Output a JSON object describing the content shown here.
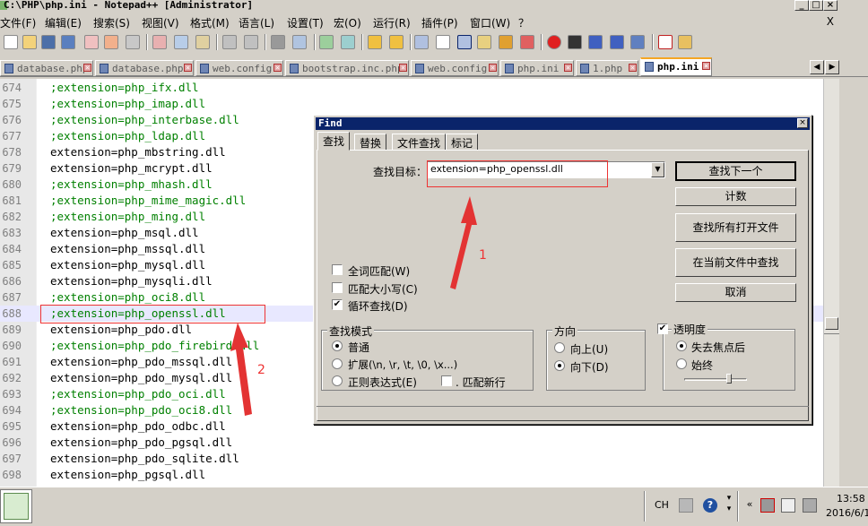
{
  "window": {
    "title": "C:\\PHP\\php.ini - Notepad++ [Administrator]",
    "buttons": {
      "minimize": "_",
      "maximize": "□",
      "close": "×"
    }
  },
  "menu": {
    "items": [
      "文件(F)",
      "编辑(E)",
      "搜索(S)",
      "视图(V)",
      "格式(M)",
      "语言(L)",
      "设置(T)",
      "宏(O)",
      "运行(R)",
      "插件(P)",
      "窗口(W)",
      "？"
    ],
    "close": "X"
  },
  "tabs": [
    {
      "label": "database.php",
      "active": false
    },
    {
      "label": "database.php",
      "active": false
    },
    {
      "label": "web.config",
      "active": false
    },
    {
      "label": "bootstrap.inc.php",
      "active": false
    },
    {
      "label": "web.config",
      "active": false
    },
    {
      "label": "php.ini",
      "active": false
    },
    {
      "label": "1.php",
      "active": false
    },
    {
      "label": "php.ini",
      "active": true
    }
  ],
  "editor": {
    "lines": [
      {
        "n": "674",
        "text": ";extension=php_ifx.dll",
        "comment": true
      },
      {
        "n": "675",
        "text": ";extension=php_imap.dll",
        "comment": true
      },
      {
        "n": "676",
        "text": ";extension=php_interbase.dll",
        "comment": true
      },
      {
        "n": "677",
        "text": ";extension=php_ldap.dll",
        "comment": true
      },
      {
        "n": "678",
        "text": "extension=php_mbstring.dll",
        "comment": false
      },
      {
        "n": "679",
        "text": "extension=php_mcrypt.dll",
        "comment": false
      },
      {
        "n": "680",
        "text": ";extension=php_mhash.dll",
        "comment": true
      },
      {
        "n": "681",
        "text": ";extension=php_mime_magic.dll",
        "comment": true
      },
      {
        "n": "682",
        "text": ";extension=php_ming.dll",
        "comment": true
      },
      {
        "n": "683",
        "text": "extension=php_msql.dll",
        "comment": false
      },
      {
        "n": "684",
        "text": "extension=php_mssql.dll",
        "comment": false
      },
      {
        "n": "685",
        "text": "extension=php_mysql.dll",
        "comment": false
      },
      {
        "n": "686",
        "text": "extension=php_mysqli.dll",
        "comment": false
      },
      {
        "n": "687",
        "text": ";extension=php_oci8.dll",
        "comment": true
      },
      {
        "n": "688",
        "text": ";extension=php_openssl.dll",
        "comment": true
      },
      {
        "n": "689",
        "text": "extension=php_pdo.dll",
        "comment": false
      },
      {
        "n": "690",
        "text": ";extension=php_pdo_firebird.dll",
        "comment": true
      },
      {
        "n": "691",
        "text": "extension=php_pdo_mssql.dll",
        "comment": false
      },
      {
        "n": "692",
        "text": "extension=php_pdo_mysql.dll",
        "comment": false
      },
      {
        "n": "693",
        "text": ";extension=php_pdo_oci.dll",
        "comment": true
      },
      {
        "n": "694",
        "text": ";extension=php_pdo_oci8.dll",
        "comment": true
      },
      {
        "n": "695",
        "text": "extension=php_pdo_odbc.dll",
        "comment": false
      },
      {
        "n": "696",
        "text": "extension=php_pdo_pgsql.dll",
        "comment": false
      },
      {
        "n": "697",
        "text": "extension=php_pdo_sqlite.dll",
        "comment": false
      },
      {
        "n": "698",
        "text": "extension=php_pgsql.dll",
        "comment": false
      }
    ],
    "current_line": "688"
  },
  "find_dialog": {
    "title": "Find",
    "close": "×",
    "tabs": [
      "查找",
      "替换",
      "文件查找",
      "标记"
    ],
    "active_tab": "查找",
    "target_label": "查找目标：",
    "target_value": "extension=php_openssl.dll",
    "buttons": {
      "find_next": "查找下一个",
      "count": "计数",
      "find_all_open": "查找所有打开文件",
      "find_in_current": "在当前文件中查找",
      "cancel": "取消"
    },
    "options": {
      "whole_word": {
        "label": "全词匹配(W)",
        "checked": false
      },
      "match_case": {
        "label": "匹配大小写(C)",
        "checked": false
      },
      "wrap": {
        "label": "循环查找(D)",
        "checked": true
      }
    },
    "search_mode": {
      "title": "查找模式",
      "normal": "普通",
      "extended": "扩展(\\n, \\r, \\t, \\0, \\x...)",
      "regex": "正则表达式(E)",
      "dot_newline": ". 匹配新行",
      "selected": "普通"
    },
    "direction": {
      "title": "方向",
      "up": "向上(U)",
      "down": "向下(D)",
      "selected": "向下(D)"
    },
    "transparency": {
      "label": "透明度",
      "checked": true,
      "on_lose_focus": "失去焦点后",
      "always": "始终",
      "selected": "失去焦点后"
    }
  },
  "annotations": {
    "label1": "1",
    "label2": "2",
    "color": "#e33333"
  },
  "taskbar": {
    "lang": "CH",
    "time": "13:58",
    "date": "2016/6/1"
  }
}
